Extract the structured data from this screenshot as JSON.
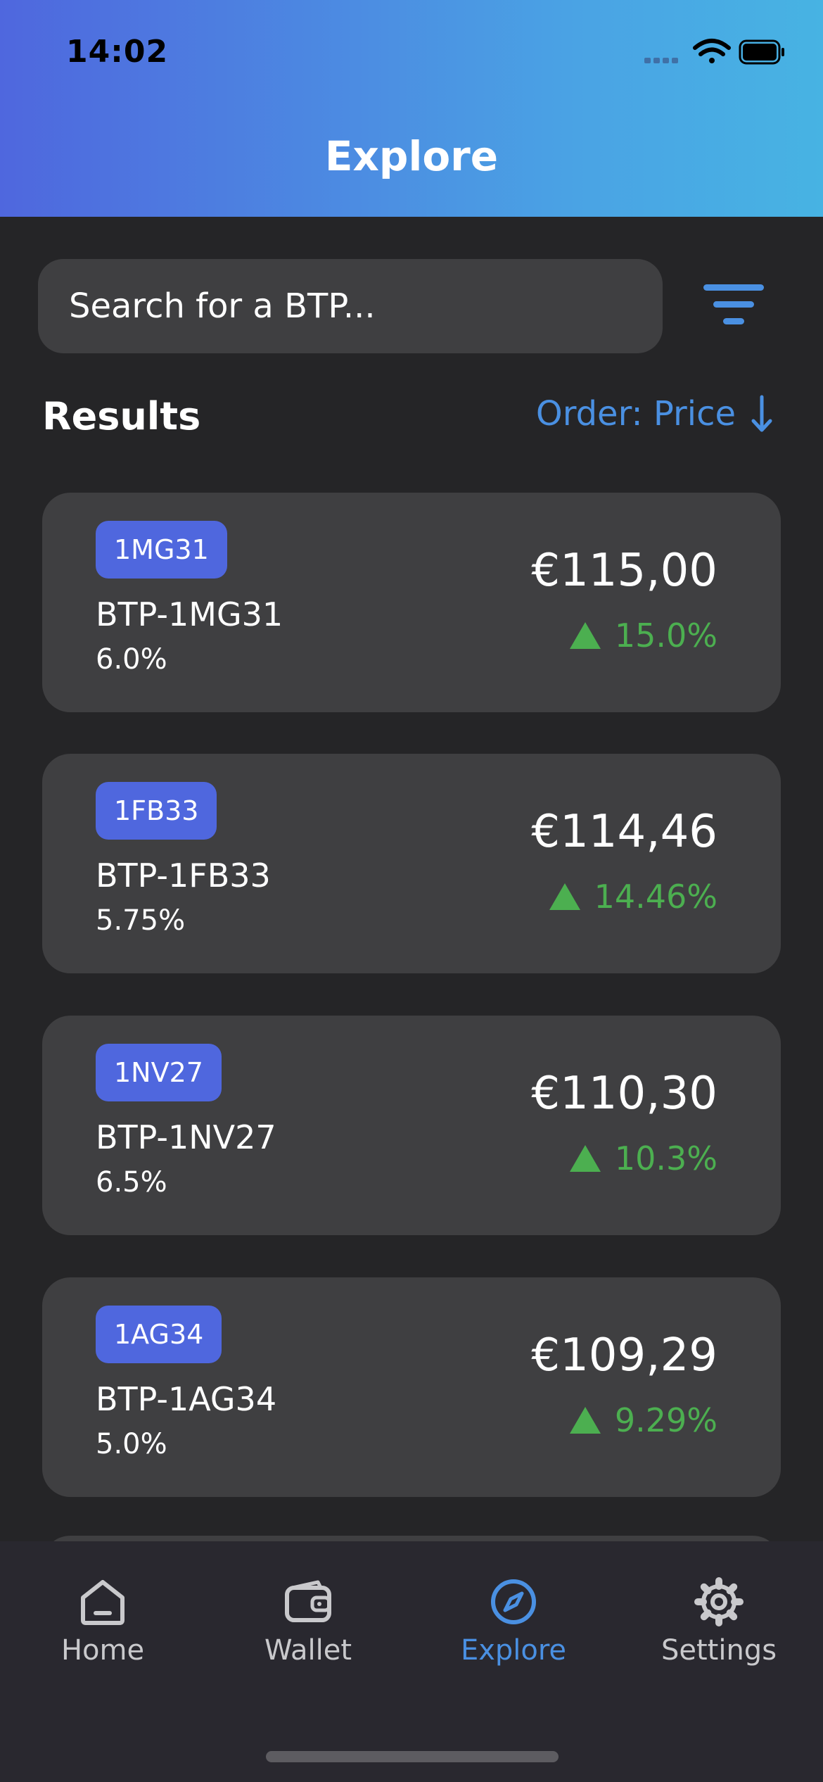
{
  "status_bar": {
    "time": "14:02"
  },
  "header": {
    "title": "Explore"
  },
  "search": {
    "placeholder": "Search for a BTP..."
  },
  "results": {
    "label": "Results",
    "order_label": "Order: Price"
  },
  "cards": [
    {
      "badge": "1MG31",
      "name": "BTP-1MG31",
      "yield": "6.0%",
      "price": "€115,00",
      "change": "15.0%"
    },
    {
      "badge": "1FB33",
      "name": "BTP-1FB33",
      "yield": "5.75%",
      "price": "€114,46",
      "change": "14.46%"
    },
    {
      "badge": "1NV27",
      "name": "BTP-1NV27",
      "yield": "6.5%",
      "price": "€110,30",
      "change": "10.3%"
    },
    {
      "badge": "1AG34",
      "name": "BTP-1AG34",
      "yield": "5.0%",
      "price": "€109,29",
      "change": "9.29%"
    }
  ],
  "tabbar": {
    "tabs": [
      {
        "label": "Home",
        "icon": "home-icon"
      },
      {
        "label": "Wallet",
        "icon": "wallet-icon"
      },
      {
        "label": "Explore",
        "icon": "compass-icon",
        "active": true
      },
      {
        "label": "Settings",
        "icon": "gear-icon"
      }
    ]
  },
  "colors": {
    "accent": "#4a90e2",
    "badge": "#4f67de",
    "positive": "#4caf50",
    "background": "#252527",
    "card": "#3f3f41"
  }
}
